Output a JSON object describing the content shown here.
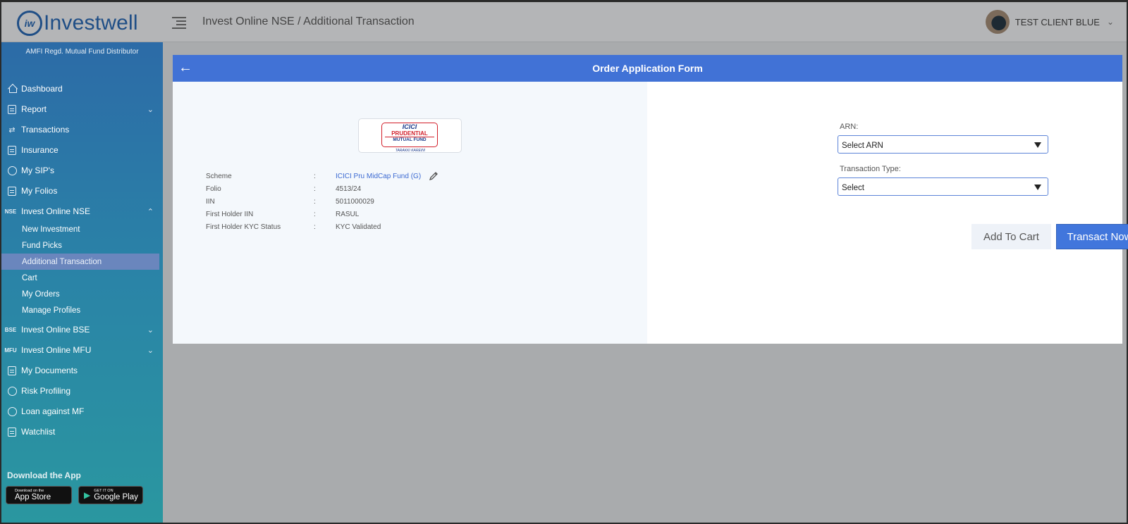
{
  "app": {
    "brand": "Investwell",
    "logo_mark": "iw",
    "subtitle": "AMFI Regd. Mutual Fund Distributor"
  },
  "header": {
    "breadcrumb": "Invest Online NSE / Additional Transaction",
    "user_name": "TEST CLIENT BLUE",
    "user_chevron": "⌄",
    "menu_icon": "menu-collapse-icon"
  },
  "sidebar": {
    "items": [
      {
        "label": "Dashboard",
        "icon": "home-icon"
      },
      {
        "label": "Report",
        "icon": "report-icon",
        "chevron": "⌄"
      },
      {
        "label": "Transactions",
        "icon": "⇄"
      },
      {
        "label": "Insurance",
        "icon": "insurance-icon"
      },
      {
        "label": "My SIP's",
        "icon": "sip-icon"
      },
      {
        "label": "My Folios",
        "icon": "folio-icon"
      },
      {
        "label": "Invest Online NSE",
        "icon": "NSE",
        "chevron": "⌃"
      },
      {
        "label": "Invest Online BSE",
        "icon": "BSE",
        "chevron": "⌄"
      },
      {
        "label": "Invest Online MFU",
        "icon": "MFU",
        "chevron": "⌄"
      },
      {
        "label": "My Documents",
        "icon": "document-icon"
      },
      {
        "label": "Risk Profiling",
        "icon": "gauge-icon"
      },
      {
        "label": "Loan against MF",
        "icon": "loan-icon"
      },
      {
        "label": "Watchlist",
        "icon": "watchlist-icon"
      }
    ],
    "nse_subitems": [
      {
        "label": "New Investment"
      },
      {
        "label": "Fund Picks"
      },
      {
        "label": "Additional Transaction",
        "active": true
      },
      {
        "label": "Cart"
      },
      {
        "label": "My Orders"
      },
      {
        "label": "Manage Profiles"
      }
    ],
    "download_title": "Download the App",
    "app_store": {
      "small": "Download on the",
      "big": "App Store",
      "icon": ""
    },
    "google_play": {
      "small": "GET IT ON",
      "big": "Google Play",
      "icon": "▶"
    }
  },
  "card": {
    "title": "Order Application Form",
    "back_icon": "←",
    "fund_logo": {
      "line1": "ICICI",
      "line2": "PRUDENTIAL",
      "line3": "MUTUAL FUND",
      "tagline": "TARAKKI KAREIN!"
    },
    "details": [
      {
        "label": "Scheme",
        "sep": ":",
        "value": "ICICI Pru MidCap Fund (G)"
      },
      {
        "label": "Folio",
        "sep": ":",
        "value": "4513/24"
      },
      {
        "label": "IIN",
        "sep": ":",
        "value": "5011000029"
      },
      {
        "label": "First Holder IIN",
        "sep": ":",
        "value": "RASUL"
      },
      {
        "label": "First Holder KYC Status",
        "sep": ":",
        "value": "KYC Validated"
      }
    ],
    "arn": {
      "label": "ARN:",
      "value": "Select ARN"
    },
    "transaction_type": {
      "label": "Transaction Type:",
      "value": "Select"
    },
    "buttons": {
      "add_to_cart": "Add To Cart",
      "transact_now": "Transact Now"
    }
  },
  "colors": {
    "header_bar": "#4172d6",
    "primary_button": "#4176dc",
    "link": "#3c6ad2",
    "brand": "#1f4e86",
    "active_sidebar": "#6a86bd"
  }
}
